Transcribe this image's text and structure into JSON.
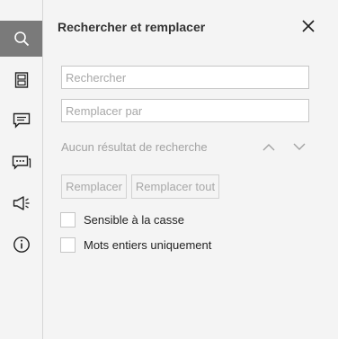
{
  "sidebar": {
    "items": [
      {
        "icon": "search-icon",
        "active": true
      },
      {
        "icon": "slides-icon",
        "active": false
      },
      {
        "icon": "comment-icon",
        "active": false
      },
      {
        "icon": "chat-icon",
        "active": false
      },
      {
        "icon": "megaphone-icon",
        "active": false
      },
      {
        "icon": "info-icon",
        "active": false
      }
    ]
  },
  "panel": {
    "title": "Rechercher et remplacer",
    "search_placeholder": "Rechercher",
    "replace_placeholder": "Remplacer par",
    "no_result_text": "Aucun résultat de recherche",
    "replace_button": "Remplacer",
    "replace_all_button": "Remplacer tout",
    "options": [
      {
        "label": "Sensible à la casse",
        "checked": false
      },
      {
        "label": "Mots entiers uniquement",
        "checked": false
      }
    ]
  },
  "colors": {
    "active_rail_bg": "#7a7a7a",
    "panel_bg": "#f4f4f4",
    "disabled_text": "#a8a8a8"
  }
}
